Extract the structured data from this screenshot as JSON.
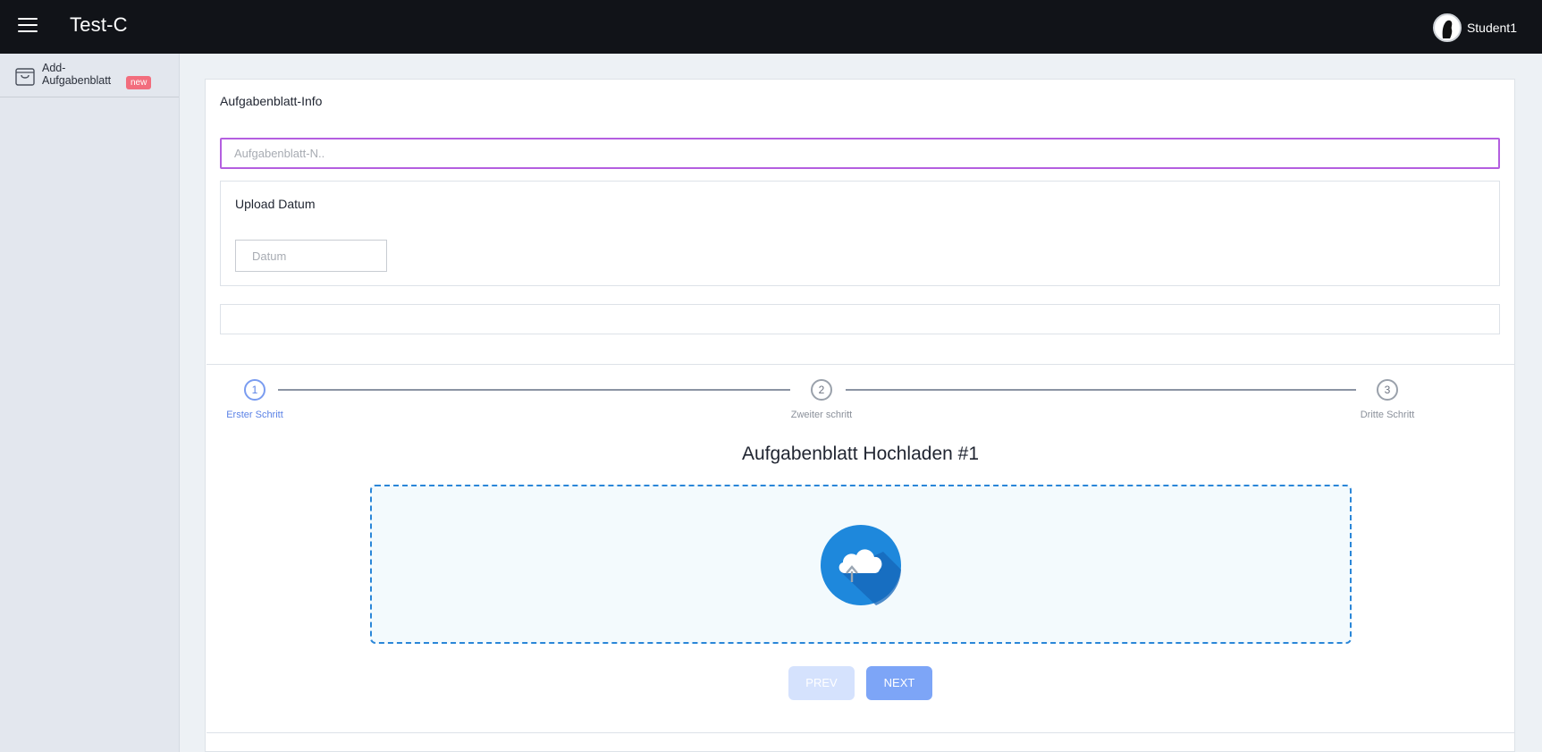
{
  "topbar": {
    "brand": "Test-C",
    "user_name": "Student1"
  },
  "sidebar": {
    "items": [
      {
        "label": "Add-Aufgabenblatt",
        "badge": "new",
        "icon": "shopping-bag-icon"
      }
    ]
  },
  "form": {
    "title": "Aufgabenblatt-Info",
    "name_placeholder": "Aufgabenblatt-N..",
    "upload_date_title": "Upload Datum",
    "date_placeholder": "Datum"
  },
  "stepper": {
    "steps": [
      {
        "number": "1",
        "label": "Erster Schritt",
        "active": true
      },
      {
        "number": "2",
        "label": "Zweiter schritt",
        "active": false
      },
      {
        "number": "3",
        "label": "Dritte Schritt",
        "active": false
      }
    ],
    "upload_heading": "Aufgabenblatt Hochladen #1",
    "prev_label": "PREV",
    "next_label": "NEXT"
  },
  "colors": {
    "topbar": "#111318",
    "active_step": "#5b82e6",
    "input_focus": "#b45fe0",
    "dropzone_border": "#2a86d8",
    "badge": "#f26d7d"
  }
}
